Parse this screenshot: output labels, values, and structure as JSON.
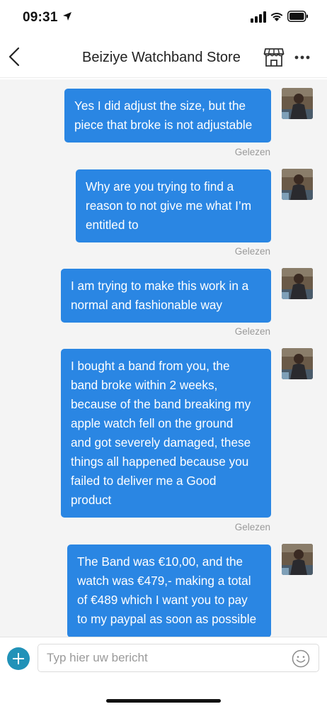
{
  "status_bar": {
    "time": "09:31",
    "location_icon": "location-arrow-icon",
    "signal_icon": "cellular-signal-icon",
    "wifi_icon": "wifi-icon",
    "battery_icon": "battery-icon"
  },
  "header": {
    "title": "Beiziye Watchband Store",
    "back_icon": "chevron-left-icon",
    "store_icon": "store-icon",
    "more_icon": "more-dots-icon"
  },
  "messages": [
    {
      "lines": [
        "Yes I did adjust the size, but the",
        "piece that broke is not adjustable"
      ],
      "status": "Gelezen"
    },
    {
      "lines": [
        "Why are you trying to find a",
        "reason to not give me what I’m",
        "entitled to"
      ],
      "status": "Gelezen"
    },
    {
      "lines": [
        "I am trying to make this work in a",
        "normal and fashionable way"
      ],
      "status": "Gelezen"
    },
    {
      "lines": [
        "I bought a band from you, the",
        "band broke within 2 weeks,",
        "because of the band breaking my",
        "apple watch fell on the ground",
        "and got severely damaged, these",
        "things all happened because you",
        "failed to deliver me a Good",
        "product"
      ],
      "status": "Gelezen"
    },
    {
      "lines": [
        "The Band was €10,00, and the",
        "watch was €479,- making a total",
        "of €489 which I want you to pay",
        "to my paypal as soon as possible"
      ],
      "status": ""
    }
  ],
  "composer": {
    "placeholder": "Typ hier uw bericht",
    "value": "",
    "add_icon": "plus-icon",
    "emoji_icon": "emoji-icon"
  },
  "colors": {
    "bubble": "#2a86e3",
    "add_button": "#2192b8",
    "chat_background": "#f4f4f4"
  }
}
